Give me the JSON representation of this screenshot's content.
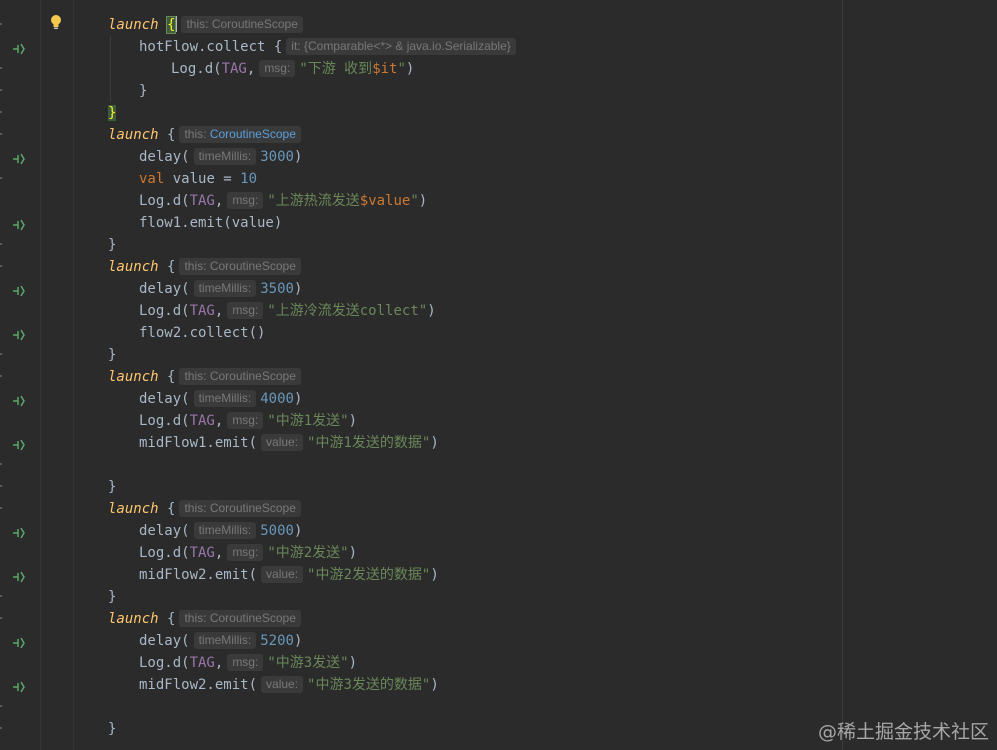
{
  "editor": {
    "blocks": [
      {
        "launch": "launch",
        "brace": "{",
        "hint_label": "this:",
        "hint_value": "CoroutineScope"
      },
      {
        "launch": "launch",
        "brace": "{",
        "hint_label": "this:",
        "hint_value": "CoroutineScope"
      },
      {
        "launch": "launch",
        "brace": "{",
        "hint_label": "this:",
        "hint_value": "CoroutineScope"
      },
      {
        "launch": "launch",
        "brace": "{",
        "hint_label": "this:",
        "hint_value": "CoroutineScope"
      },
      {
        "launch": "launch",
        "brace": "{",
        "hint_label": "this:",
        "hint_value": "CoroutineScope"
      },
      {
        "launch": "launch",
        "brace": "{",
        "hint_label": "this:",
        "hint_value": "CoroutineScope"
      }
    ],
    "b0": {
      "collect_call": "hotFlow.collect {",
      "collect_hint": "it: {Comparable<*> & java.io.Serializable}",
      "log_prefix": "Log.d(",
      "log_tag": "TAG",
      "log_comma": ",",
      "msg_hint": "msg:",
      "str_open": "\"下游 收到",
      "tmpl": "$it",
      "str_close": "\"",
      "log_close": ")",
      "inner_close": "}",
      "outer_close": "}"
    },
    "b1": {
      "delay_prefix": "delay(",
      "delay_hint": "timeMillis:",
      "delay_value": "3000",
      "delay_close": ")",
      "val_kw": "val",
      "val_rest": " value = ",
      "val_num": "10",
      "log_prefix": "Log.d(",
      "log_tag": "TAG",
      "log_comma": ",",
      "msg_hint": "msg:",
      "str_open": "\"上游热流发送",
      "tmpl": "$value",
      "str_close": "\"",
      "log_close": ")",
      "emit": "flow1.emit(value)",
      "close": "}"
    },
    "b2": {
      "delay_prefix": "delay(",
      "delay_hint": "timeMillis:",
      "delay_value": "3500",
      "delay_close": ")",
      "log_prefix": "Log.d(",
      "log_tag": "TAG",
      "log_comma": ",",
      "msg_hint": "msg:",
      "str": "\"上游冷流发送collect\"",
      "log_close": ")",
      "collect": "flow2.collect()",
      "close": "}"
    },
    "b3": {
      "delay_prefix": "delay(",
      "delay_hint": "timeMillis:",
      "delay_value": "4000",
      "delay_close": ")",
      "log_prefix": "Log.d(",
      "log_tag": "TAG",
      "log_comma": ",",
      "msg_hint": "msg:",
      "str": "\"中游1发送\"",
      "log_close": ")",
      "emit_prefix": "midFlow1.emit(",
      "emit_hint": "value:",
      "emit_str": "\"中游1发送的数据\"",
      "emit_close": ")",
      "close": "}"
    },
    "b4": {
      "delay_prefix": "delay(",
      "delay_hint": "timeMillis:",
      "delay_value": "5000",
      "delay_close": ")",
      "log_prefix": "Log.d(",
      "log_tag": "TAG",
      "log_comma": ",",
      "msg_hint": "msg:",
      "str": "\"中游2发送\"",
      "log_close": ")",
      "emit_prefix": "midFlow2.emit(",
      "emit_hint": "value:",
      "emit_str": "\"中游2发送的数据\"",
      "emit_close": ")",
      "close": "}"
    },
    "b5": {
      "delay_prefix": "delay(",
      "delay_hint": "timeMillis:",
      "delay_value": "5200",
      "delay_close": ")",
      "log_prefix": "Log.d(",
      "log_tag": "TAG",
      "log_comma": ",",
      "msg_hint": "msg:",
      "str": "\"中游3发送\"",
      "log_close": ")",
      "emit_prefix": "midFlow2.emit(",
      "emit_hint": "value:",
      "emit_str": "\"中游3发送的数据\"",
      "emit_close": ")",
      "close": "}"
    }
  },
  "gutter": {
    "suspend_icon": "suspend-call-icon",
    "intention_icon": "lightbulb-icon"
  },
  "watermark": {
    "text": "@稀土掘金技术社区"
  },
  "colors": {
    "background": "#2b2b2b",
    "keyword": "#cc7832",
    "function": "#ffc66d",
    "number": "#6897bb",
    "string": "#6a8759",
    "constant": "#9876aa",
    "text": "#a9b7c6",
    "hint_active": "#5c9fdb"
  }
}
